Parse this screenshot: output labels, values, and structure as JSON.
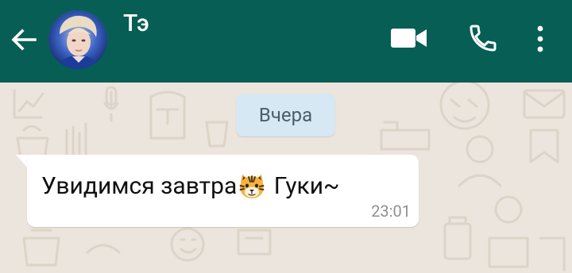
{
  "header": {
    "back_icon": "arrow-left-icon",
    "contact_name": "Тэ",
    "video_icon": "videocam-icon",
    "call_icon": "phone-icon",
    "menu_icon": "more-vert-icon",
    "bg_color": "#075e54"
  },
  "chat": {
    "date_label": "Вчера",
    "messages": [
      {
        "text_before": "Увидимся завтра",
        "emoji": "tiger-face-emoji",
        "text_after": " Гуки~",
        "time": "23:01"
      }
    ],
    "bg_color": "#ece5dd",
    "date_chip_color": "#d5e8f4"
  }
}
